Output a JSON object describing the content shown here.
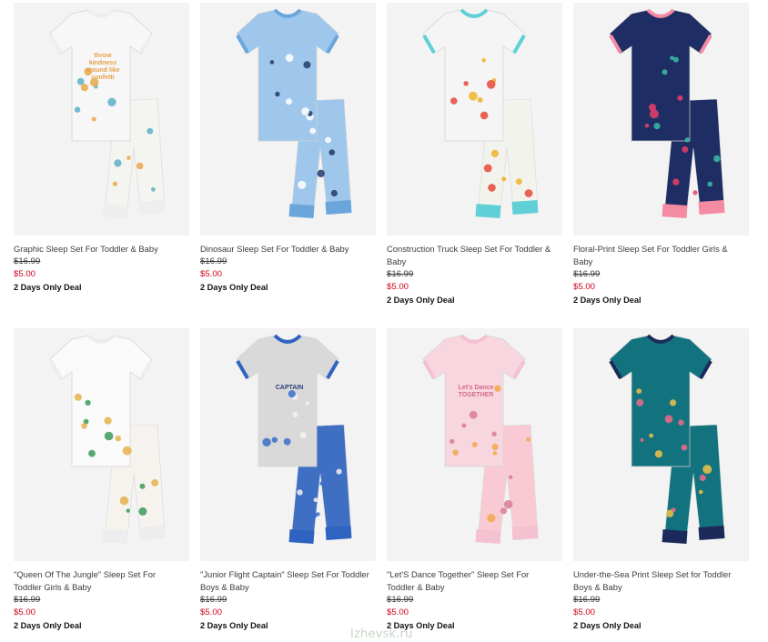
{
  "products": [
    {
      "title": "Graphic Sleep Set For Toddler & Baby",
      "old_price": "$16.99",
      "new_price": "$5.00",
      "badge": "2 Days Only Deal",
      "image": "white tee with rainbow text and printed white pants",
      "shirt_text": [
        "throw",
        "kindness",
        "around like",
        "confetti"
      ],
      "colors": {
        "shirt": "#f7f7f7",
        "pants": "#f4f4f0",
        "accent": "#e9a84c",
        "accent2": "#5bb0c9",
        "trim": "#eeeeee"
      }
    },
    {
      "title": "Dinosaur Sleep Set For Toddler & Baby",
      "old_price": "$16.99",
      "new_price": "$5.00",
      "badge": "2 Days Only Deal",
      "image": "light blue striped tee with navy dinosaurs and matching pants",
      "colors": {
        "shirt": "#9fc7ec",
        "pants": "#9fc7ec",
        "accent": "#213a6b",
        "accent2": "#ffffff",
        "trim": "#6aa6dc"
      }
    },
    {
      "title": "Construction Truck Sleep Set For Toddler & Baby",
      "old_price": "$16.99",
      "new_price": "$5.00",
      "badge": "2 Days Only Deal",
      "image": "white tee with trucks and colorful truck-print pants",
      "colors": {
        "shirt": "#f5f5f5",
        "pants": "#f3f3ee",
        "accent": "#e5493a",
        "accent2": "#f0b32c",
        "trim": "#5fd0d6"
      }
    },
    {
      "title": "Floral-Print Sleep Set For Toddler Girls & Baby",
      "old_price": "$16.99",
      "new_price": "$5.00",
      "badge": "2 Days Only Deal",
      "image": "navy floral tee with pink collar and navy floral pants",
      "colors": {
        "shirt": "#1e2d63",
        "pants": "#1e2d63",
        "accent": "#e8406a",
        "accent2": "#3bbba5",
        "trim": "#f58aa3"
      }
    },
    {
      "title": "\"Queen Of The Jungle\" Sleep Set For Toddler Girls & Baby",
      "old_price": "$16.99",
      "new_price": "$5.00",
      "badge": "2 Days Only Deal",
      "image": "white tee with cheetah graphic and cheetah-print pants",
      "colors": {
        "shirt": "#fafafa",
        "pants": "#f6f3ee",
        "accent": "#e6b24a",
        "accent2": "#3a9a5a",
        "trim": "#ededed"
      }
    },
    {
      "title": "\"Junior Flight Captain\" Sleep Set For Toddler Boys & Baby",
      "old_price": "$16.99",
      "new_price": "$5.00",
      "badge": "2 Days Only Deal",
      "image": "heather gray tee with blue collar and blue airplane pants",
      "shirt_text": [
        "CAPTAIN"
      ],
      "colors": {
        "shirt": "#d9d9d9",
        "pants": "#3f6fc2",
        "accent": "#3a6fc9",
        "accent2": "#f2f2f2",
        "trim": "#2f63c2"
      }
    },
    {
      "title": "\"Let'S Dance Together\" Sleep Set For Toddler & Baby",
      "old_price": "$16.99",
      "new_price": "$5.00",
      "badge": "2 Days Only Deal",
      "image": "light pink tee with ballerinas and striped pink pants",
      "shirt_text": [
        "Let's Dance",
        "TOGETHER"
      ],
      "colors": {
        "shirt": "#f8d6df",
        "pants": "#f9c9d4",
        "accent": "#d97a98",
        "accent2": "#f2a84b",
        "trim": "#f3c1cf"
      }
    },
    {
      "title": "Under-the-Sea Print Sleep Set for Toddler Boys & Baby",
      "old_price": "$16.99",
      "new_price": "$5.00",
      "badge": "2 Days Only Deal",
      "image": "teal tee with sea creatures and matching pants",
      "colors": {
        "shirt": "#12737e",
        "pants": "#12737e",
        "accent": "#f0c24a",
        "accent2": "#f06a8a",
        "trim": "#1b2a5a"
      }
    }
  ],
  "watermark": "Izhevsk.ru"
}
